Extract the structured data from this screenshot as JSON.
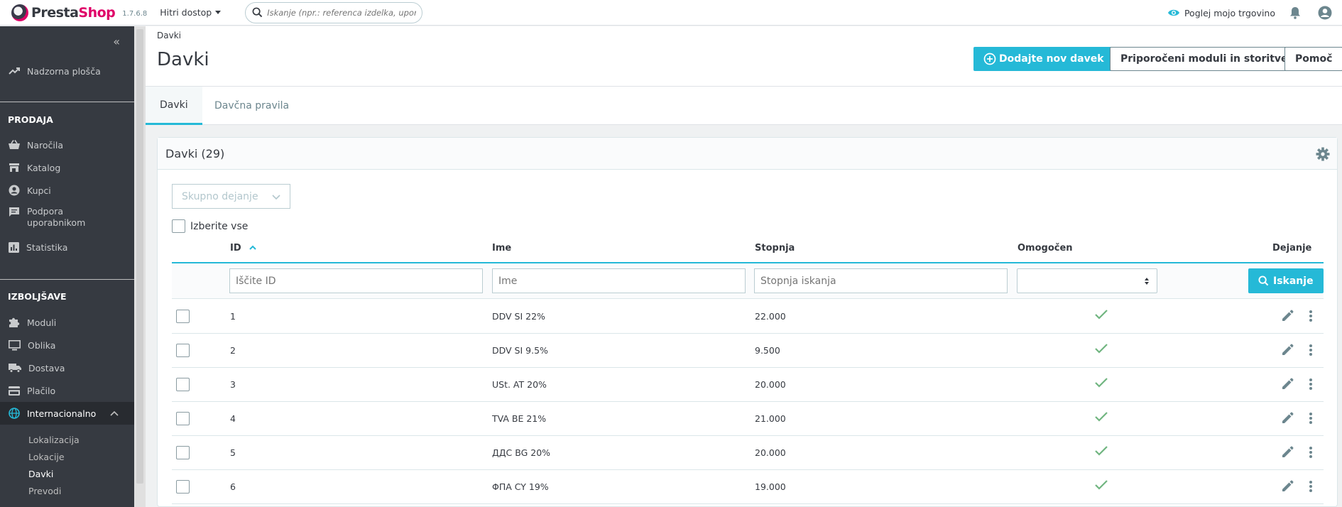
{
  "topbar": {
    "logo_presta": "Presta",
    "logo_shop": "Shop",
    "version": "1.7.6.8",
    "quick_access": "Hitri dostop",
    "search_placeholder": "Iskanje (npr.: referenca izdelka, uporabnik)",
    "view_shop": "Poglej mojo trgovino"
  },
  "sidebar": {
    "collapse_glyph": "«",
    "dashboard": "Nadzorna plošča",
    "section_sell": "PRODAJA",
    "orders": "Naročila",
    "catalog": "Katalog",
    "customers": "Kupci",
    "support_line1": "Podpora",
    "support_line2": "uporabnikom",
    "stats": "Statistika",
    "section_improve": "IZBOLJŠAVE",
    "modules": "Moduli",
    "design": "Oblika",
    "shipping": "Dostava",
    "payment": "Plačilo",
    "international": "Internacionalno",
    "sub_items": [
      "Lokalizacija",
      "Lokacije",
      "Davki",
      "Prevodi"
    ]
  },
  "header": {
    "breadcrumb": "Davki",
    "title": "Davki",
    "add_button": "Dodajte nov davek",
    "recommended_button": "Priporočeni moduli in storitve",
    "help_button": "Pomoč"
  },
  "tabs": [
    "Davki",
    "Davčna pravila"
  ],
  "card": {
    "title": "Davki (29)",
    "bulk_actions": "Skupno dejanje",
    "select_all": "Izberite vse"
  },
  "table": {
    "columns": {
      "id": "ID",
      "name": "Ime",
      "rate": "Stopnja",
      "enabled": "Omogočen",
      "actions": "Dejanje"
    },
    "filters": {
      "id_placeholder": "Iščite ID",
      "name_placeholder": "Ime",
      "rate_placeholder": "Stopnja iskanja",
      "search_button": "Iskanje"
    },
    "rows": [
      {
        "id": "1",
        "name": "DDV SI 22%",
        "rate": "22.000"
      },
      {
        "id": "2",
        "name": "DDV SI 9.5%",
        "rate": "9.500"
      },
      {
        "id": "3",
        "name": "USt. AT 20%",
        "rate": "20.000"
      },
      {
        "id": "4",
        "name": "TVA BE 21%",
        "rate": "21.000"
      },
      {
        "id": "5",
        "name": "ДДС BG 20%",
        "rate": "20.000"
      },
      {
        "id": "6",
        "name": "ΦΠΑ CY 19%",
        "rate": "19.000"
      }
    ]
  },
  "colors": {
    "accent": "#25b9d7",
    "brand": "#df0067",
    "sidebar_bg": "#363a41",
    "check_green": "#70b580"
  }
}
